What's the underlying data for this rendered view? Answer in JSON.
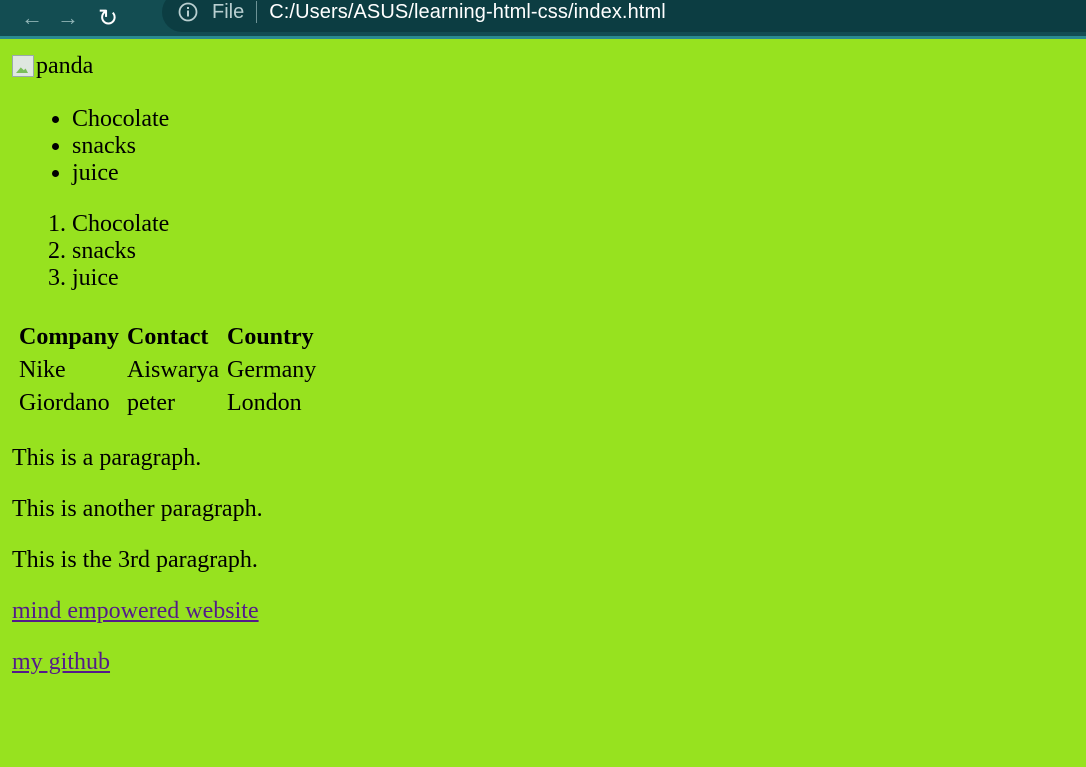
{
  "browser": {
    "file_label": "File",
    "url": "C:/Users/ASUS/learning-html-css/index.html"
  },
  "page": {
    "image_alt": "panda",
    "unordered_list": [
      "Chocolate",
      "snacks",
      "juice"
    ],
    "ordered_list": [
      "Chocolate",
      "snacks",
      "juice"
    ],
    "table": {
      "headers": [
        "Company",
        "Contact",
        "Country"
      ],
      "rows": [
        [
          "Nike",
          "Aiswarya",
          "Germany"
        ],
        [
          "Giordano",
          "peter",
          "London"
        ]
      ]
    },
    "paragraphs": [
      "This is a paragraph.",
      "This is another paragraph.",
      "This is the 3rd paragraph."
    ],
    "links": [
      "mind empowered website",
      "my github"
    ]
  },
  "colors": {
    "page_background": "#97e21f",
    "toolbar": "#134d52",
    "link": "#551a8b"
  }
}
